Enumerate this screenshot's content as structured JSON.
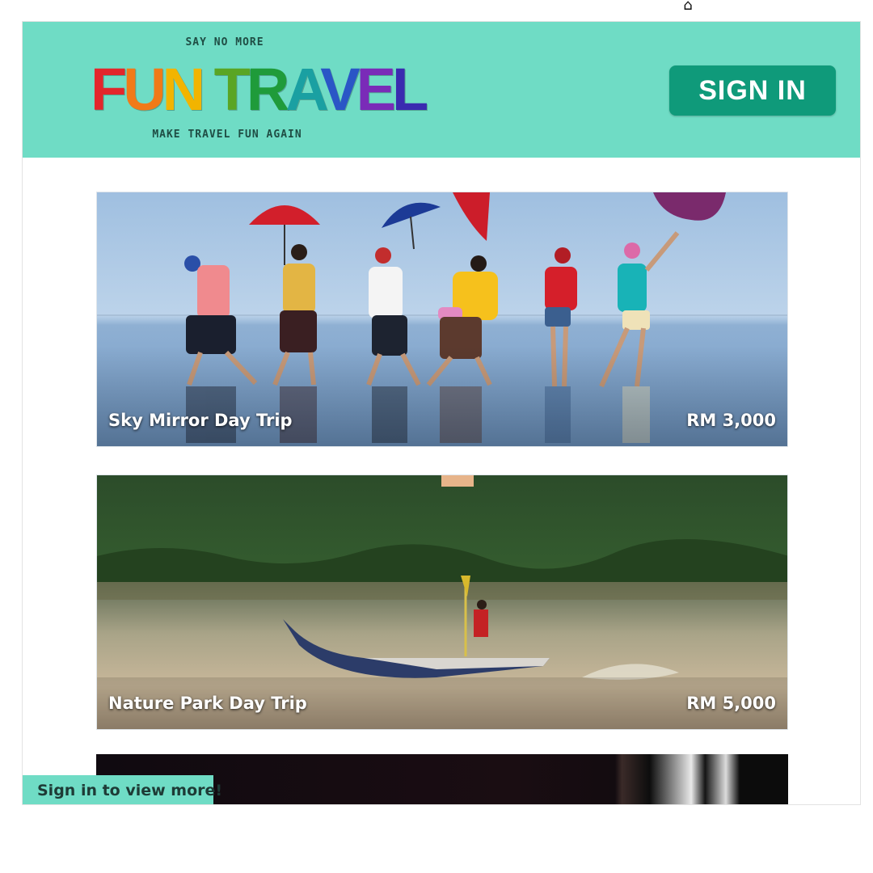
{
  "window": {
    "top_icon": "mouse-icon"
  },
  "header": {
    "tagline_top": "SAY NO MORE",
    "logo_letters": [
      {
        "char": "F",
        "color": "#e3262b"
      },
      {
        "char": "U",
        "color": "#f07a18"
      },
      {
        "char": "N",
        "color": "#f2b400"
      },
      {
        "char": " ",
        "color": "#000000"
      },
      {
        "char": "T",
        "color": "#5aa524"
      },
      {
        "char": "R",
        "color": "#1f9b3a"
      },
      {
        "char": "A",
        "color": "#1aa0a2"
      },
      {
        "char": "V",
        "color": "#2a56c6"
      },
      {
        "char": "E",
        "color": "#7a2bb8"
      },
      {
        "char": "L",
        "color": "#3a2bb0"
      }
    ],
    "logo_text": "FUN TRAVEL",
    "tagline_bottom": "MAKE TRAVEL FUN AGAIN",
    "sign_in_label": "SIGN IN"
  },
  "trips": [
    {
      "title": "Sky Mirror Day Trip",
      "price": "RM 3,000"
    },
    {
      "title": "Nature Park Day Trip",
      "price": "RM 5,000"
    }
  ],
  "banner": {
    "text": "Sign in to view more!"
  },
  "colors": {
    "header_bg": "#6fdcc5",
    "button_bg": "#0f9a7a"
  }
}
